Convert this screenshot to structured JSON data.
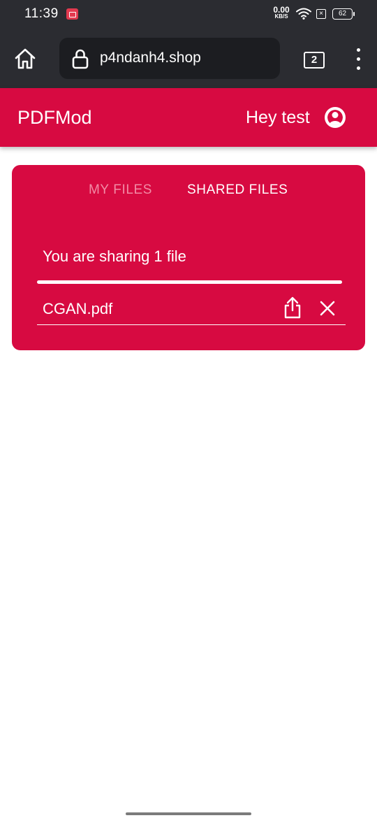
{
  "status_bar": {
    "time": "11:39",
    "net_speed_value": "0.00",
    "net_speed_unit": "KB/S",
    "battery": "62",
    "x_box": "×"
  },
  "browser": {
    "url": "p4ndanh4.shop",
    "tab_count": "2"
  },
  "app": {
    "brand": "PDFMod",
    "greeting": "Hey test"
  },
  "tabs": [
    {
      "label": "MY FILES",
      "active": false
    },
    {
      "label": "SHARED FILES",
      "active": true
    }
  ],
  "shared": {
    "summary": "You are sharing 1 file",
    "progress": 1.0,
    "files": [
      {
        "name": "CGAN.pdf"
      }
    ]
  },
  "icons": [
    "recording-icon",
    "wifi-icon",
    "home-icon",
    "lock-icon",
    "account-icon",
    "share-icon",
    "close-icon",
    "more-vert-icon"
  ],
  "colors": {
    "primary": "#d70a41",
    "browser_bg": "#2b2c31",
    "url_bg": "#1c1d21",
    "inactive_tab": "#f28ba5"
  }
}
